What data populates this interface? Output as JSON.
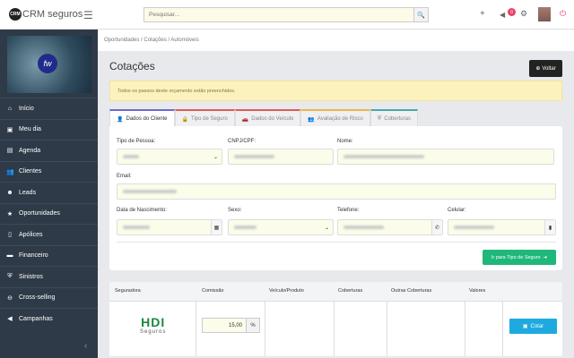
{
  "header": {
    "logo_text": "CRM seguros",
    "search_placeholder": "Pesquisar...",
    "notification_count": "0"
  },
  "sidebar": {
    "items": [
      {
        "label": "Início",
        "icon": "home-icon"
      },
      {
        "label": "Meu dia",
        "icon": "calendar-day-icon"
      },
      {
        "label": "Agenda",
        "icon": "calendar-icon"
      },
      {
        "label": "Clientes",
        "icon": "users-icon"
      },
      {
        "label": "Leads",
        "icon": "user-group-icon"
      },
      {
        "label": "Oportunidades",
        "icon": "star-icon"
      },
      {
        "label": "Apólices",
        "icon": "file-icon"
      },
      {
        "label": "Financeiro",
        "icon": "credit-card-icon"
      },
      {
        "label": "Sinistros",
        "icon": "shield-icon"
      },
      {
        "label": "Cross-selling",
        "icon": "exchange-icon"
      },
      {
        "label": "Campanhas",
        "icon": "megaphone-icon"
      }
    ]
  },
  "breadcrumb": "Oportunidades / Cotações / Automóveis",
  "page": {
    "title": "Cotações",
    "back_label": "Voltar",
    "alert": "Todos os passos deste orçamento estão preenchidos."
  },
  "tabs": [
    {
      "label": "Dados do Cliente",
      "color": "#6a6ad0"
    },
    {
      "label": "Tipo de Seguro",
      "color": "#e05a5a"
    },
    {
      "label": "Dados do Veículo",
      "color": "#e05a5a"
    },
    {
      "label": "Avaliação de Risco",
      "color": "#e8b84a"
    },
    {
      "label": "Coberturas",
      "color": "#4aa8a8"
    }
  ],
  "form": {
    "tipo_pessoa": "Tipo de Pessoa:",
    "cnpj": "CNPJ/CPF:",
    "nome": "Nome:",
    "email": "Email:",
    "nascimento": "Data de Nascimento:",
    "sexo": "Sexo:",
    "telefone": "Telefone:",
    "celular": "Celular:",
    "next_label": "Ir para Tipo de Seguro"
  },
  "table": {
    "headers": [
      "Seguradora",
      "Comissão",
      "Veículo/Produto",
      "Coberturas",
      "Outras Coberturas",
      "Valores"
    ],
    "row": {
      "insurer_logo": "HDI",
      "insurer_sub": "Seguros",
      "commission": "15,00",
      "commission_unit": "%",
      "action": "Cotar"
    }
  }
}
